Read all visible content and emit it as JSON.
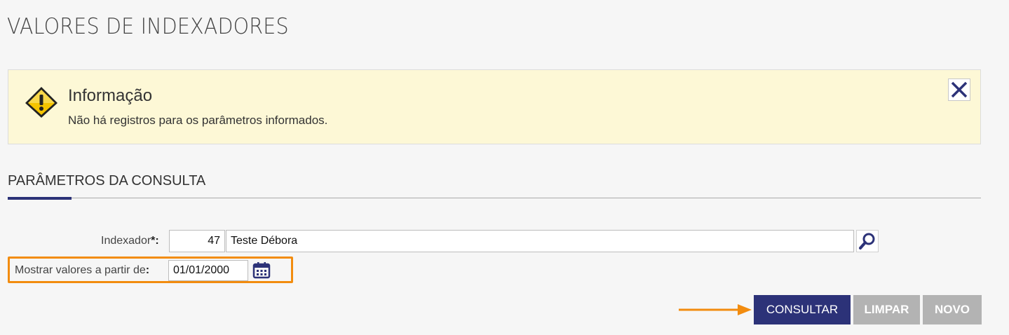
{
  "page": {
    "title": "VALORES DE INDEXADORES"
  },
  "info": {
    "title": "Informação",
    "message": "Não há registros para os parâmetros informados.",
    "icon": "warning-icon",
    "close_icon": "close-icon"
  },
  "section": {
    "title": "PARÂMETROS DA CONSULTA"
  },
  "form": {
    "indexador": {
      "label": "Indexador",
      "required_mark": "*:",
      "code": "47",
      "name": "Teste Débora"
    },
    "mostrar": {
      "label": "Mostrar valores a partir de",
      "colon": ":",
      "date": "01/01/2000"
    }
  },
  "buttons": {
    "consultar": "CONSULTAR",
    "limpar": "LIMPAR",
    "novo": "NOVO"
  },
  "colors": {
    "primary": "#2c3278",
    "highlight": "#f28c0f",
    "info_bg": "#fdf8d6",
    "disabled": "#b3b3b3"
  }
}
